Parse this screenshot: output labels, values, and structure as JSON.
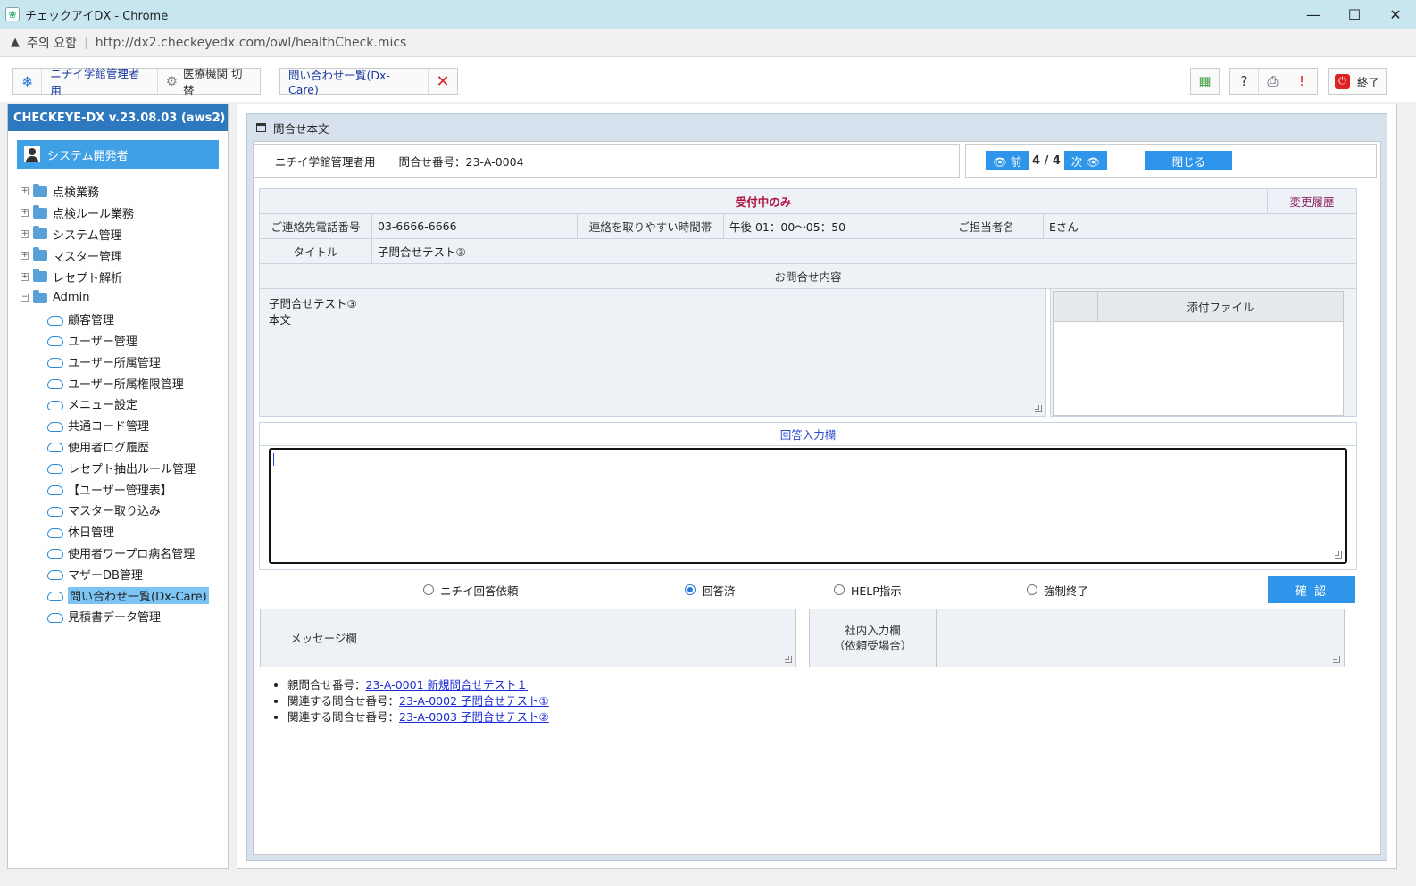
{
  "window": {
    "title": "チェックアイDX - Chrome",
    "minimize": "—",
    "maximize": "☐",
    "close": "✕"
  },
  "address": {
    "warning_icon": "warning-icon",
    "security_label": "주의 요함",
    "separator": "|",
    "url": "http://dx2.checkeyedx.com/owl/healthCheck.mics"
  },
  "toolbar": {
    "org_label": "ニチイ学館管理者用",
    "switch_label": "医療機関 切替",
    "inquiry_tab_label": "問い合わせ一覧(Dx-Care)",
    "exit_label": "終了"
  },
  "sidebar": {
    "version": "CHECKEYE-DX v.23.08.03 (aws2)",
    "collapse_icon": "‹",
    "user": "システム開発者",
    "folders": [
      {
        "label": "点検業務",
        "expanded": false
      },
      {
        "label": "点検ルール業務",
        "expanded": false
      },
      {
        "label": "システム管理",
        "expanded": false
      },
      {
        "label": "マスター管理",
        "expanded": false
      },
      {
        "label": "レセプト解析",
        "expanded": false
      },
      {
        "label": "Admin",
        "expanded": true
      }
    ],
    "admin_items": [
      "顧客管理",
      "ユーザー管理",
      "ユーザー所属管理",
      "ユーザー所属権限管理",
      "メニュー設定",
      "共通コード管理",
      "使用者ログ履歴",
      "レセプト抽出ルール管理",
      "【ユーザー管理表】",
      "マスター取り込み",
      "休日管理",
      "使用者ワープロ病名管理",
      "マザーDB管理",
      "問い合わせ一覧(Dx-Care)",
      "見積書データ管理"
    ],
    "active_item": "問い合わせ一覧(Dx-Care)"
  },
  "panel": {
    "title": "問合せ本文",
    "org": "ニチイ学館管理者用",
    "inquiry_no_label": "問合せ番号：23-A-0004",
    "prev_label": "👁 前",
    "page": "4 / 4",
    "next_label": "次 👁",
    "close_label": "閉じる",
    "status": "受付中のみ",
    "history_link": "変更履歴",
    "phone_label": "ご連絡先電話番号",
    "phone_value": "03-6666-6666",
    "time_label": "連絡を取りやすい時間帯",
    "time_value": "午後  01：00～05：50",
    "person_label": "ご担当者名",
    "person_value": "Eさん",
    "title_label": "タイトル",
    "title_value": "子問合せテスト③",
    "content_header": "お問合せ内容",
    "content_lines": [
      "子問合せテスト③",
      "本文"
    ],
    "attach_header": "添付ファイル",
    "answer_header": "回答入力欄",
    "answer_value": "",
    "radios": [
      {
        "label": "ニチイ回答依頼",
        "checked": false
      },
      {
        "label": "回答済",
        "checked": true
      },
      {
        "label": "HELP指示",
        "checked": false
      },
      {
        "label": "強制終了",
        "checked": false
      }
    ],
    "confirm_label": "確 認",
    "message_label": "メッセージ欄",
    "internal_label_1": "社内入力欄",
    "internal_label_2": "（依頼受場合）",
    "links": [
      {
        "prefix": "親問合せ番号：",
        "link": "23-A-0001 新規問合せテスト１"
      },
      {
        "prefix": "関連する問合せ番号：",
        "link": "23-A-0002 子問合せテスト①"
      },
      {
        "prefix": "関連する問合せ番号：",
        "link": "23-A-0003 子問合せテスト②"
      }
    ]
  }
}
